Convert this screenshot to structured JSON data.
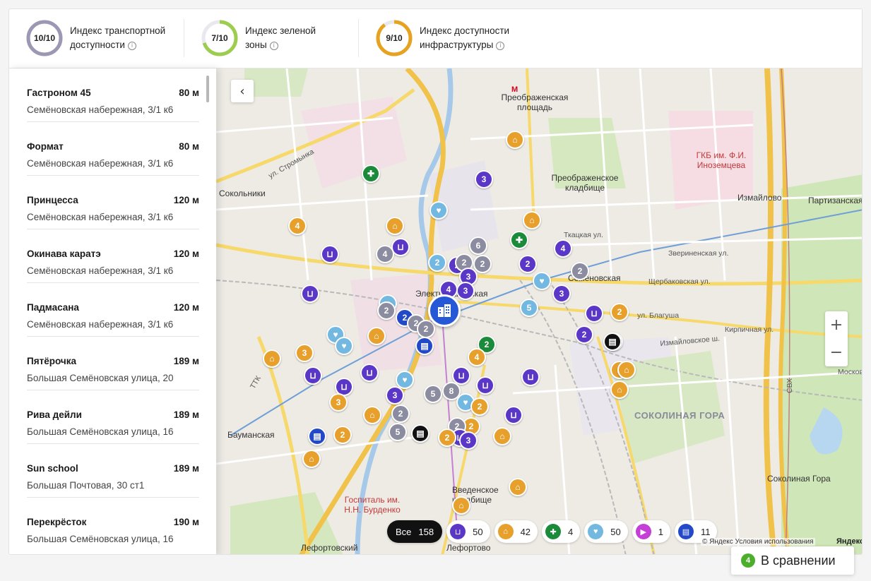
{
  "indices": [
    {
      "score": "10/10",
      "label": "Индекс транспортной доступности",
      "value": 1.0,
      "color": "#9c98b4"
    },
    {
      "score": "7/10",
      "label": "Индекс зеленой зоны",
      "value": 0.7,
      "color": "#9ccd4e"
    },
    {
      "score": "9/10",
      "label": "Индекс доступности инфраструктуры",
      "value": 0.9,
      "color": "#e6a320"
    }
  ],
  "places": [
    {
      "name": "Гастроном 45",
      "distance": "80 м",
      "address": "Семёновская набережная, 3/1 к6"
    },
    {
      "name": "Формат",
      "distance": "80 м",
      "address": "Семёновская набережная, 3/1 к6"
    },
    {
      "name": "Принцесса",
      "distance": "120 м",
      "address": "Семёновская набережная, 3/1 к6"
    },
    {
      "name": "Окинава каратэ",
      "distance": "120 м",
      "address": "Семёновская набережная, 3/1 к6"
    },
    {
      "name": "Падмасана",
      "distance": "120 м",
      "address": "Семёновская набережная, 3/1 к6"
    },
    {
      "name": "Пятёрочка",
      "distance": "189 м",
      "address": "Большая Семёновская улица, 20"
    },
    {
      "name": "Рива дейли",
      "distance": "189 м",
      "address": "Большая Семёновская улица, 16"
    },
    {
      "name": "Sun school",
      "distance": "189 м",
      "address": "Большая Почтовая, 30 ст1"
    },
    {
      "name": "Перекрёсток",
      "distance": "190 м",
      "address": "Большая Семёновская улица, 16"
    }
  ],
  "map_labels": {
    "preobr_sq": "Преображенская площадь",
    "preobr_cem": "Преображенское кладбище",
    "gkb": "ГКБ им. Ф.И. Иноземцева",
    "izmailovo": "Измайлово",
    "partizanskaya": "Партизанская",
    "sokolniki": "Сокольники",
    "semenovskaya": "Семёновская",
    "elektrozavodskaya": "Электрозаводская",
    "baumanskaya": "Бауманская",
    "sokolinaya_gora": "СОКОЛИНАЯ ГОРА",
    "sokolinaya_gora_m": "Соколиная Гора",
    "gospital": "Госпиталь им. Н.Н. Бурденко",
    "vvedenskoe": "Введенское кладбище",
    "lefortovo": "Лефортово",
    "lefortovsky": "Лефортовский",
    "stromynka": "ул. Стромынка",
    "tkatskaya": "Ткацкая ул.",
    "shcherbakovskaya": "Щербаковская ул.",
    "izm_sh": "Измайловское ш.",
    "zverinetskaya": "Звериненская ул.",
    "ttk": "ТТК",
    "svh": "СВХ",
    "moskov": "Москов",
    "blagusha": "ул. Благуша",
    "kirpichnaya": "Кирпичная ул."
  },
  "filters": {
    "all_label": "Все",
    "all_count": "158",
    "chips": [
      {
        "icon": "shop-icon",
        "count": "50",
        "color": "#5a37c7"
      },
      {
        "icon": "education-icon",
        "count": "42",
        "color": "#e7a02b"
      },
      {
        "icon": "medical-icon",
        "count": "4",
        "color": "#1b8a3a"
      },
      {
        "icon": "sport-icon",
        "count": "50",
        "color": "#72b8e0"
      },
      {
        "icon": "entertainment-icon",
        "count": "1",
        "color": "#c33fd6"
      },
      {
        "icon": "bank-icon",
        "count": "11",
        "color": "#2349c9"
      }
    ]
  },
  "copyright": "© Яндекс Условия использования",
  "yandex": "Яндекс",
  "compare": {
    "count": "4",
    "label": "В сравнении"
  }
}
